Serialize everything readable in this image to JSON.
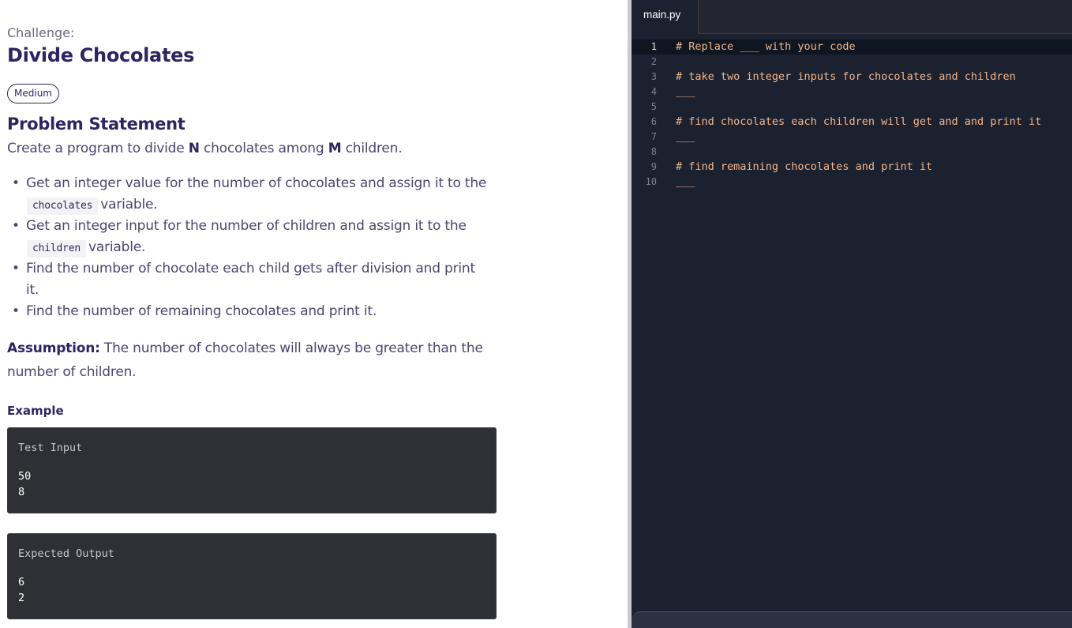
{
  "problem": {
    "challenge_label": "Challenge:",
    "title": "Divide Chocolates",
    "difficulty": "Medium",
    "statement_heading": "Problem Statement",
    "statement": {
      "pre": "Create a program to divide ",
      "n": "N",
      "mid": " chocolates among ",
      "m": "M",
      "post": " children."
    },
    "bullets": {
      "b1_text": "Get an integer value for the number of chocolates and assign it to the",
      "b1_code": "chocolates",
      "b1_tail": "variable.",
      "b2_text": "Get an integer input for the number of children and assign it to the",
      "b2_code": "children",
      "b2_tail": "variable.",
      "b3_text": "Find the number of chocolate each child gets after division and print it.",
      "b4_text": "Find the number of remaining chocolates and print it."
    },
    "assumption": {
      "label": "Assumption:",
      "text": " The number of chocolates will always be greater than the number of children."
    },
    "example_label": "Example",
    "test_input": {
      "title": "Test Input",
      "lines": [
        "50",
        "8"
      ]
    },
    "expected_output": {
      "title": "Expected Output",
      "lines": [
        "6",
        "2"
      ]
    }
  },
  "editor": {
    "tab": "main.py",
    "active_line": 1,
    "lines": [
      {
        "num": "1",
        "code": "# Replace ___ with your code"
      },
      {
        "num": "2",
        "code": ""
      },
      {
        "num": "3",
        "code": "# take two integer inputs for chocolates and children"
      },
      {
        "num": "4",
        "code": "___"
      },
      {
        "num": "5",
        "code": ""
      },
      {
        "num": "6",
        "code": "# find chocolates each children will get and and print it"
      },
      {
        "num": "7",
        "code": "___"
      },
      {
        "num": "8",
        "code": ""
      },
      {
        "num": "9",
        "code": "# find remaining chocolates and print it"
      },
      {
        "num": "10",
        "code": "___"
      }
    ]
  }
}
